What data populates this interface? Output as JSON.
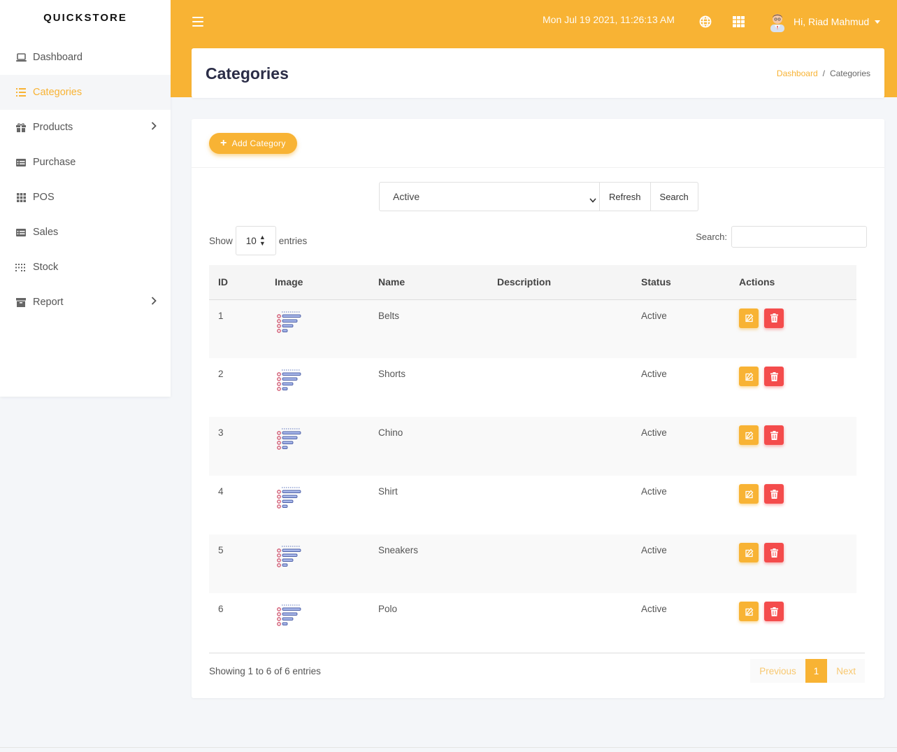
{
  "sidebar": {
    "brand": "QUICKSTORE",
    "items": [
      {
        "label": "Dashboard",
        "icon": "laptop-icon",
        "active": false,
        "has_children": false
      },
      {
        "label": "Categories",
        "icon": "list-icon",
        "active": true,
        "has_children": false
      },
      {
        "label": "Products",
        "icon": "gift-icon",
        "active": false,
        "has_children": true
      },
      {
        "label": "Purchase",
        "icon": "table-list-icon",
        "active": false,
        "has_children": false
      },
      {
        "label": "POS",
        "icon": "grid-icon",
        "active": false,
        "has_children": false
      },
      {
        "label": "Sales",
        "icon": "table-list-icon",
        "active": false,
        "has_children": false
      },
      {
        "label": "Stock",
        "icon": "dots-grid-icon",
        "active": false,
        "has_children": false
      },
      {
        "label": "Report",
        "icon": "archive-icon",
        "active": false,
        "has_children": true
      }
    ]
  },
  "header": {
    "datetime": "Mon Jul 19 2021, 11:26:13 AM",
    "user_greeting": "Hi, Riad Mahmud"
  },
  "page": {
    "title": "Categories",
    "breadcrumb": {
      "home": "Dashboard",
      "current": "Categories"
    }
  },
  "toolbar": {
    "add_label": "Add Category",
    "status_filter": "Active",
    "refresh_label": "Refresh",
    "search_label": "Search"
  },
  "datatable": {
    "show_label": "Show",
    "page_length": "10",
    "entries_label": "entries",
    "search_label": "Search:",
    "search_value": "",
    "columns": [
      "ID",
      "Image",
      "Name",
      "Description",
      "Status",
      "Actions"
    ],
    "rows": [
      {
        "id": "1",
        "name": "Belts",
        "description": "",
        "status": "Active"
      },
      {
        "id": "2",
        "name": "Shorts",
        "description": "",
        "status": "Active"
      },
      {
        "id": "3",
        "name": "Chino",
        "description": "",
        "status": "Active"
      },
      {
        "id": "4",
        "name": "Shirt",
        "description": "",
        "status": "Active"
      },
      {
        "id": "5",
        "name": "Sneakers",
        "description": "",
        "status": "Active"
      },
      {
        "id": "6",
        "name": "Polo",
        "description": "",
        "status": "Active"
      }
    ],
    "info": "Showing 1 to 6 of 6 entries",
    "pagination": {
      "previous": "Previous",
      "current": "1",
      "next": "Next"
    }
  },
  "colors": {
    "accent": "#f8b334",
    "danger": "#f44c4c",
    "title": "#2b2d47",
    "background": "#f4f6f9"
  }
}
